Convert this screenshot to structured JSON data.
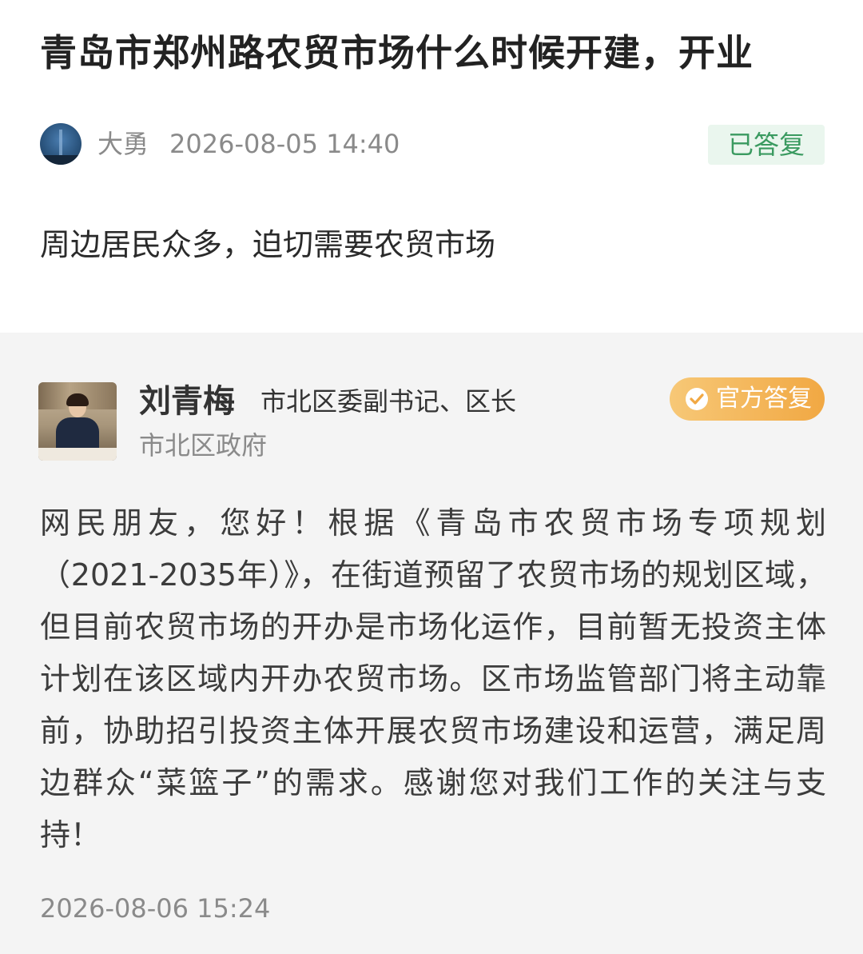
{
  "question": {
    "title": "青岛市郑州路农贸市场什么时候开建，开业",
    "asker_name": "大勇",
    "asked_time": "2026-08-05 14:40",
    "status": "已答复",
    "body": "周边居民众多，迫切需要农贸市场"
  },
  "answer": {
    "official_name": "刘青梅",
    "official_title": "市北区委副书记、区长",
    "organization": "市北区政府",
    "badge_label": "官方答复",
    "body": "网民朋友，您好！根据《青岛市农贸市场专项规划（2021-2035年）》，在街道预留了农贸市场的规划区域，但目前农贸市场的开办是市场化运作，目前暂无投资主体计划在该区域内开办农贸市场。区市场监管部门将主动靠前，协助招引投资主体开展农贸市场建设和运营，满足周边群众“菜篮子”的需求。感谢您对我们工作的关注与支持！",
    "reply_time": "2026-08-06 15:24"
  },
  "colors": {
    "status_green": "#3a9a60",
    "badge_orange": "#f1a843",
    "answer_background": "#f4f4f4"
  },
  "icons": {
    "asker_avatar": "avatar-landscape",
    "official_badge": "verified-check-icon"
  }
}
